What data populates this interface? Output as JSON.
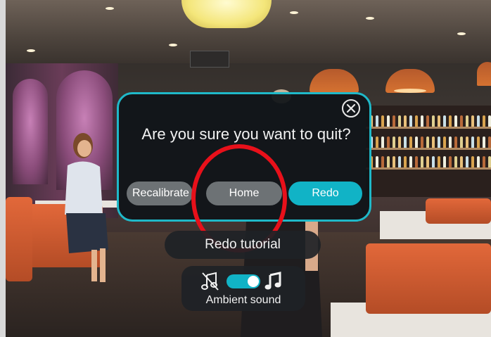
{
  "dialog": {
    "title": "Are you sure you want to quit?",
    "close_icon": "close-circle-icon",
    "buttons": [
      {
        "label": "Recalibrate",
        "style": "secondary"
      },
      {
        "label": "Home",
        "style": "secondary"
      },
      {
        "label": "Redo",
        "style": "primary"
      }
    ]
  },
  "tutorial": {
    "label": "Redo tutorial"
  },
  "ambient_sound": {
    "label": "Ambient sound",
    "enabled": true,
    "off_icon": "music-muted-icon",
    "on_icon": "music-note-icon"
  },
  "colors": {
    "accent": "#11b3c6",
    "dialog_border": "#1fb9c9",
    "secondary": "#6d7275",
    "highlight": "#e8101a"
  }
}
